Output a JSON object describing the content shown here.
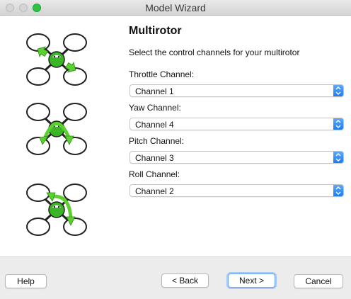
{
  "window": {
    "title": "Model Wizard"
  },
  "main": {
    "heading": "Multirotor",
    "subtitle": "Select the control channels for your multirotor",
    "fields": [
      {
        "label": "Throttle Channel:",
        "value": "Channel 1"
      },
      {
        "label": "Yaw Channel:",
        "value": "Channel 4"
      },
      {
        "label": "Pitch Channel:",
        "value": "Channel 3"
      },
      {
        "label": "Roll Channel:",
        "value": "Channel 2"
      }
    ]
  },
  "buttons": {
    "help": "Help",
    "back": "< Back",
    "next": "Next >",
    "cancel": "Cancel"
  },
  "colors": {
    "accent": "#1a7cf3",
    "arrow_green": "#5bd12f",
    "quad_body": "#3ab525"
  },
  "illustrations": [
    "quad-throttle-icon",
    "quad-yaw-icon",
    "quad-pitch-roll-icon"
  ]
}
